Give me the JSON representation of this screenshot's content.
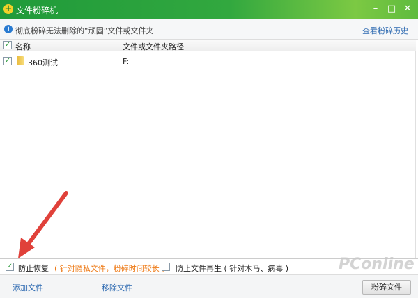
{
  "window": {
    "title": "文件粉碎机",
    "minimize": "–",
    "maximize": "□",
    "close": "✕"
  },
  "info": {
    "text": "彻底粉碎无法删除的“顽固”文件或文件夹",
    "history_link": "查看粉碎历史"
  },
  "table": {
    "columns": [
      "名称",
      "文件或文件夹路径"
    ],
    "rows": [
      {
        "name": "360测试",
        "path": "F:",
        "checked": true
      }
    ]
  },
  "options": {
    "prevent_recovery": "防止恢复",
    "prevent_recovery_note": "( 针对隐私文件，粉碎时间较长 )",
    "prevent_regen": "防止文件再生 ( 针对木马、病毒 )",
    "check_mark": "✓"
  },
  "actions": {
    "add": "添加文件",
    "remove": "移除文件",
    "shred": "粉碎文件"
  },
  "watermark": "PConline"
}
